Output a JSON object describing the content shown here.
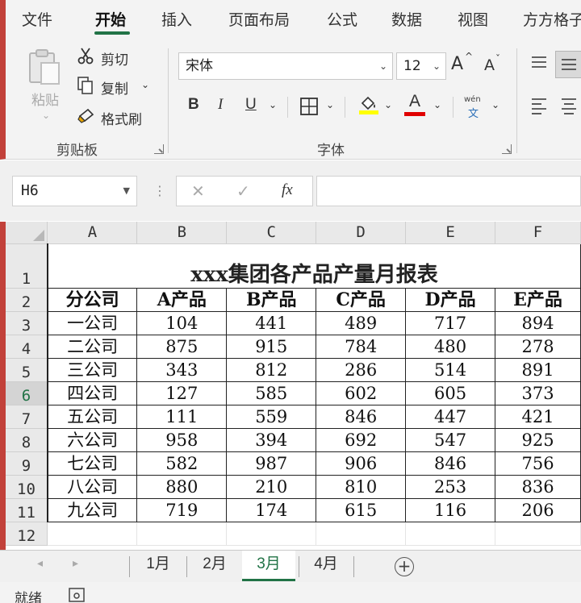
{
  "ribbon_tabs": [
    "文件",
    "开始",
    "插入",
    "页面布局",
    "公式",
    "数据",
    "视图",
    "方方格子"
  ],
  "active_tab": "开始",
  "clipboard": {
    "paste_label": "粘贴",
    "cut_label": "剪切",
    "copy_label": "复制",
    "format_painter_label": "格式刷",
    "group_label": "剪贴板"
  },
  "font": {
    "font_name": "宋体",
    "font_size": "12",
    "increase_label": "A",
    "decrease_label": "A",
    "bold": "B",
    "italic": "I",
    "underline": "U",
    "font_color_letter": "A",
    "phonetic_top": "wén",
    "phonetic_bottom": "文",
    "group_label": "字体",
    "fill_color": "#ffff00",
    "font_color": "#e00000"
  },
  "formula_bar": {
    "cell_ref": "H6",
    "cancel": "✕",
    "enter": "✓",
    "fx": "fx",
    "value": ""
  },
  "sheet": {
    "columns": [
      "A",
      "B",
      "C",
      "D",
      "E",
      "F"
    ],
    "row_numbers": [
      "1",
      "2",
      "3",
      "4",
      "5",
      "6",
      "7",
      "8",
      "9",
      "10",
      "11",
      "12"
    ],
    "active_row": "6",
    "title": "xxx集团各产品产量月报表",
    "headers": [
      "分公司",
      "A产品",
      "B产品",
      "C产品",
      "D产品",
      "E产品"
    ],
    "rows": [
      [
        "一公司",
        "104",
        "441",
        "489",
        "717",
        "894"
      ],
      [
        "二公司",
        "875",
        "915",
        "784",
        "480",
        "278"
      ],
      [
        "三公司",
        "343",
        "812",
        "286",
        "514",
        "891"
      ],
      [
        "四公司",
        "127",
        "585",
        "602",
        "605",
        "373"
      ],
      [
        "五公司",
        "111",
        "559",
        "846",
        "447",
        "421"
      ],
      [
        "六公司",
        "958",
        "394",
        "692",
        "547",
        "925"
      ],
      [
        "七公司",
        "582",
        "987",
        "906",
        "846",
        "756"
      ],
      [
        "八公司",
        "880",
        "210",
        "810",
        "253",
        "836"
      ],
      [
        "九公司",
        "719",
        "174",
        "615",
        "116",
        "206"
      ]
    ]
  },
  "sheet_tabs": [
    "1月",
    "2月",
    "3月",
    "4月"
  ],
  "active_sheet": "3月",
  "add_sheet": "+",
  "status_text": "就绪",
  "colors": {
    "accent": "#217346",
    "left_strip": "#c2413a"
  }
}
